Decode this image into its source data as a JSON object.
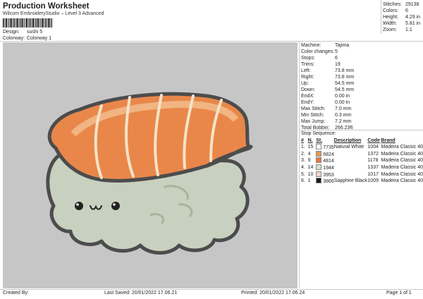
{
  "header": {
    "title": "Production Worksheet",
    "subtitle": "Wilcom EmbroideryStudio – Level 3 Advanced"
  },
  "design": {
    "design_label": "Design:",
    "design_value": "sushi 5",
    "colorway_label": "Colorway:",
    "colorway_value": "Colorway 1"
  },
  "stats": [
    {
      "k": "Stitches:",
      "v": "29138"
    },
    {
      "k": "Colors:",
      "v": "6"
    },
    {
      "k": "Height:",
      "v": "4.29 in"
    },
    {
      "k": "Width:",
      "v": "5.81 in"
    },
    {
      "k": "Zoom:",
      "v": "1:1"
    }
  ],
  "machine_info": [
    {
      "k": "Machine:",
      "v": "Tajima"
    },
    {
      "k": "Color changes:",
      "v": "5"
    },
    {
      "k": "Stops:",
      "v": "6"
    },
    {
      "k": "Trims:",
      "v": "19"
    },
    {
      "k": "Left:",
      "v": "73.8 mm"
    },
    {
      "k": "Right:",
      "v": "73.8 mm"
    },
    {
      "k": "Up:",
      "v": "54.5 mm"
    },
    {
      "k": "Down:",
      "v": "54.5 mm"
    },
    {
      "k": "EndX:",
      "v": "0.00 in"
    },
    {
      "k": "EndY:",
      "v": "0.00 in"
    },
    {
      "k": "Max Stitch:",
      "v": "7.0 mm"
    },
    {
      "k": "Min Stitch:",
      "v": "0.3 mm"
    },
    {
      "k": "Max Jump:",
      "v": "7.2 mm"
    },
    {
      "k": "Total Bobbin:",
      "v": "266.23ft"
    }
  ],
  "stop_sequence": {
    "label": "Stop Sequence:",
    "headers": [
      "#",
      "N.",
      "St.",
      "Description",
      "Code",
      "Brand"
    ],
    "rows": [
      {
        "n": "1.",
        "stop": "15",
        "st": "7735",
        "desc": "Natural White",
        "code": "1004",
        "brand": "Madeira Classic 40",
        "color": "#ffffff"
      },
      {
        "n": "2.",
        "stop": "4",
        "st": "6824",
        "desc": "",
        "code": "1372",
        "brand": "Madeira Classic 40",
        "color": "#ea9650"
      },
      {
        "n": "3.",
        "stop": "9",
        "st": "4814",
        "desc": "",
        "code": "1178",
        "brand": "Madeira Classic 40",
        "color": "#e8783c"
      },
      {
        "n": "4.",
        "stop": "14",
        "st": "1944",
        "desc": "",
        "code": "1337",
        "brand": "Madeira Classic 40",
        "color": "#d9e0cf"
      },
      {
        "n": "5.",
        "stop": "10",
        "st": "3953",
        "desc": "",
        "code": "1017",
        "brand": "Madeira Classic 40",
        "color": "#f4d2cc"
      },
      {
        "n": "6.",
        "stop": "1",
        "st": "3866",
        "desc": "Sapphire Black",
        "code": "1009",
        "brand": "Madeira Classic 40",
        "color": "#1a1a1a"
      }
    ]
  },
  "footer": {
    "created_by": "Created By:",
    "last_saved": "Last Saved: 20/01/2022 17.06.21",
    "printed": "Printed: 20/01/2022 17.06.24",
    "page": "Page 1 of 1"
  }
}
